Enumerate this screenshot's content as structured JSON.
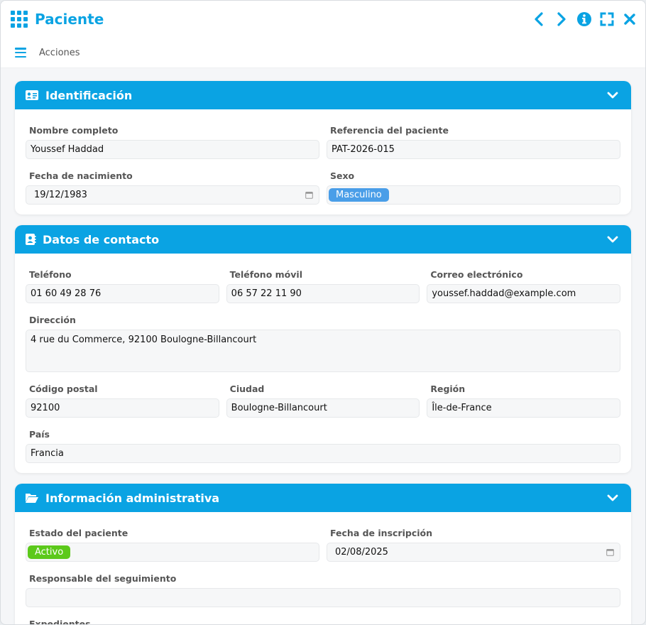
{
  "window": {
    "title": "Paciente",
    "toolbar_label": "Acciones"
  },
  "colors": {
    "accent": "#0aa3e3",
    "badge_blue": "#4a9ee8",
    "badge_green": "#5cc91a"
  },
  "sections": {
    "identificacion": {
      "title": "Identificación",
      "nombre": {
        "label": "Nombre completo",
        "value": "Youssef Haddad"
      },
      "referencia": {
        "label": "Referencia del paciente",
        "value": "PAT-2026-015"
      },
      "nacimiento": {
        "label": "Fecha de nacimiento",
        "value": "19/12/1983"
      },
      "sexo": {
        "label": "Sexo",
        "value": "Masculino"
      }
    },
    "contacto": {
      "title": "Datos de contacto",
      "telefono": {
        "label": "Teléfono",
        "value": "01 60 49 28 76"
      },
      "movil": {
        "label": "Teléfono móvil",
        "value": "06 57 22 11 90"
      },
      "correo": {
        "label": "Correo electrónico",
        "value": "youssef.haddad@example.com"
      },
      "direccion": {
        "label": "Dirección",
        "value": "4 rue du Commerce, 92100 Boulogne-Billancourt"
      },
      "postal": {
        "label": "Código postal",
        "value": "92100"
      },
      "ciudad": {
        "label": "Ciudad",
        "value": "Boulogne-Billancourt"
      },
      "region": {
        "label": "Región",
        "value": "Île-de-France"
      },
      "pais": {
        "label": "País",
        "value": "Francia"
      }
    },
    "administrativa": {
      "title": "Información administrativa",
      "estado": {
        "label": "Estado del paciente",
        "value": "Activo"
      },
      "inscripcion": {
        "label": "Fecha de inscripción",
        "value": "02/08/2025"
      },
      "responsable": {
        "label": "Responsable del seguimiento",
        "value": ""
      },
      "expedientes": {
        "label": "Expedientes"
      }
    }
  }
}
